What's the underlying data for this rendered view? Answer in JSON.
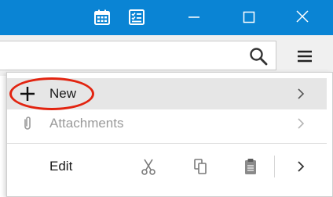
{
  "titlebar": {
    "background": "#0a84d4",
    "icons": [
      "calendar-icon",
      "tasks-icon"
    ],
    "window_controls": [
      "minimize-icon",
      "maximize-icon",
      "close-icon"
    ]
  },
  "toolbar": {
    "search_value": "",
    "icons": [
      "search-icon",
      "hamburger-menu-icon"
    ]
  },
  "menu": {
    "items": [
      {
        "label": "New",
        "icon": "plus-icon",
        "has_submenu": true,
        "enabled": true,
        "highlighted": true
      },
      {
        "label": "Attachments",
        "icon": "paperclip-icon",
        "has_submenu": true,
        "enabled": false
      }
    ],
    "edit_row": {
      "label": "Edit",
      "buttons": [
        "cut-icon",
        "copy-icon",
        "paste-icon"
      ],
      "has_submenu": true
    }
  },
  "annotation": {
    "shape": "oval",
    "color": "#e22410",
    "target": "New"
  }
}
